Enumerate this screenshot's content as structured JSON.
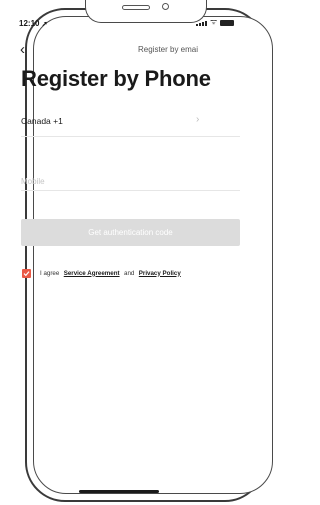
{
  "status_bar": {
    "time": "12:10"
  },
  "nav": {
    "link": "Register by emai"
  },
  "title": "Register by Phone",
  "country": {
    "label": "Canada +1"
  },
  "mobile": {
    "placeholder": "Mobile",
    "value": ""
  },
  "auth_button": {
    "label": "Get authentication code"
  },
  "agreement": {
    "checked": true,
    "prefix": "I agree",
    "service_link": "Service Agreement",
    "conjunction": "and",
    "privacy_link": "Privacy Policy"
  },
  "colors": {
    "accent": "#ea5a46",
    "button_disabled": "#dcdcdc"
  }
}
